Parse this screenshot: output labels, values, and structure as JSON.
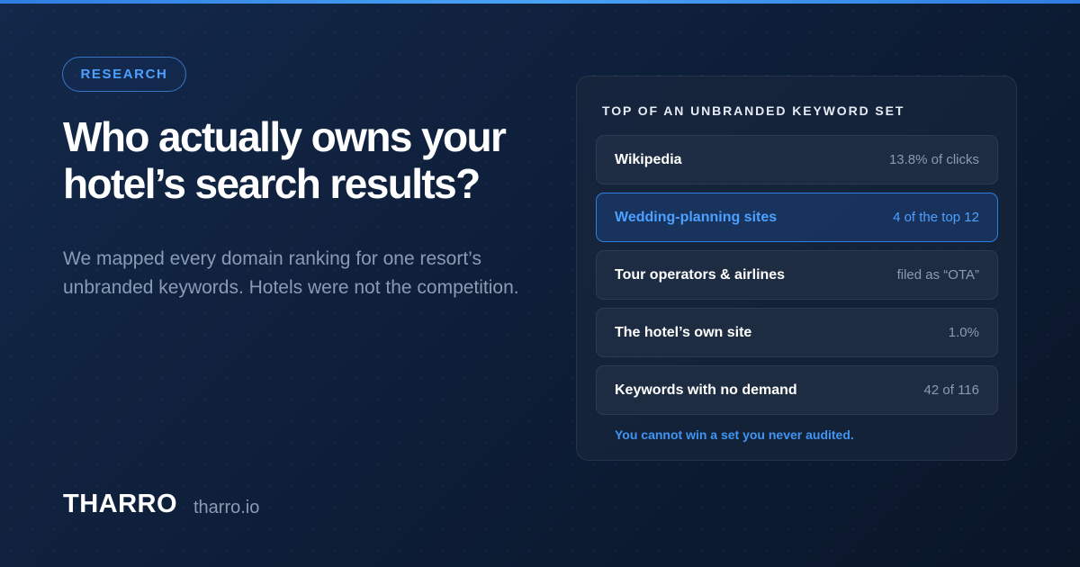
{
  "tag": "RESEARCH",
  "headline": "Who actually owns your hotel’s search results?",
  "subtext": "We mapped every domain ranking for one resort’s unbranded keywords. Hotels were not the competition.",
  "brand": "THARRO",
  "domain": "tharro.io",
  "card": {
    "title": "TOP OF AN UNBRANDED KEYWORD SET",
    "rows": [
      {
        "label": "Wikipedia",
        "value": "13.8% of clicks"
      },
      {
        "label": "Wedding-planning sites",
        "value": "4 of the top 12"
      },
      {
        "label": "Tour operators & airlines",
        "value": "filed as “OTA”"
      },
      {
        "label": "The hotel’s own site",
        "value": "1.0%"
      },
      {
        "label": "Keywords with no demand",
        "value": "42 of 116"
      }
    ],
    "footer": "You cannot win a set you never audited."
  },
  "colors": {
    "accent": "#4da0ff",
    "background": "#0d1d36",
    "muted_text": "#8a9bb4"
  }
}
